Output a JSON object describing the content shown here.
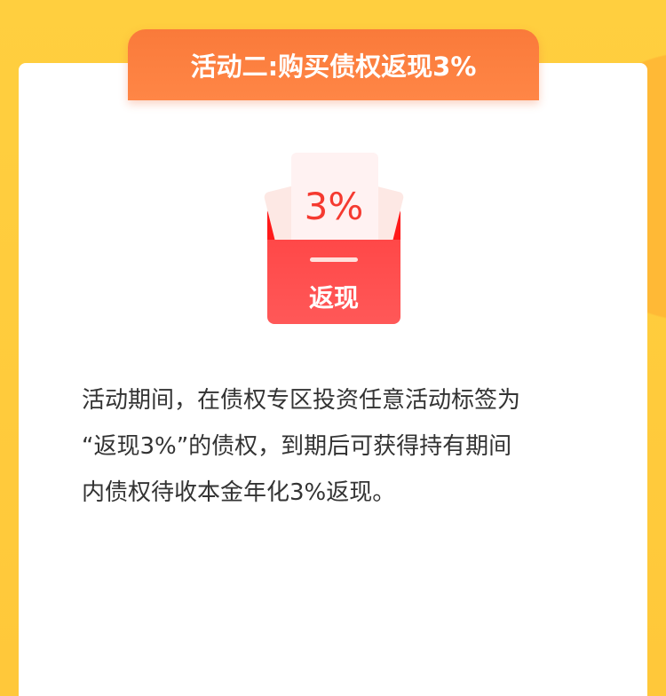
{
  "header": {
    "title": "活动二:购买债权返现3%"
  },
  "badge": {
    "percent": "3%",
    "label": "返现"
  },
  "description": {
    "lines": [
      "活动期间，在债权专区投资任意活动标签为",
      "“返现3%”的债权，到期后可获得持有期间",
      "内债权待收本金年化3%返现。"
    ]
  },
  "colors": {
    "background": "#ffcf3f",
    "tab": "#fa7a3a",
    "envelope": "#ff4848",
    "accent_text": "#f53a30"
  }
}
